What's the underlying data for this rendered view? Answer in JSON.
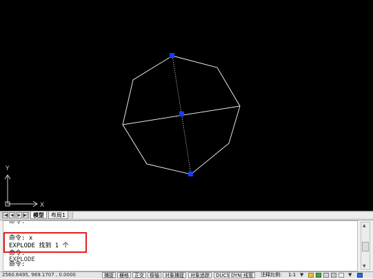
{
  "ucs": {
    "y_label": "Y",
    "x_label": "X"
  },
  "tabs": {
    "items": [
      "模型",
      "布局1"
    ]
  },
  "command_line": {
    "lines": [
      "命令:",
      "命令: x",
      "EXPLODE 找到 1 个",
      "命令:",
      "EXPLODE",
      "命令:"
    ]
  },
  "status_bar": {
    "coordinates": "2560.6495, 969.1707 , 0.0000",
    "toggles": [
      "捕捉",
      "栅格",
      "正交",
      "极轴",
      "对象捕捉",
      "对象追踪",
      "DUCS",
      "DYN",
      "线宽"
    ],
    "annotation_scale_label": "注释比例:",
    "annotation_scale_value": "1:1"
  },
  "colors": {
    "grip": "#1a3cff",
    "highlight": "#e01e1e",
    "canvas": "#000000"
  }
}
